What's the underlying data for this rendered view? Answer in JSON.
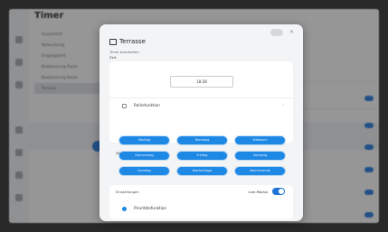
{
  "app": {
    "title": "Timer",
    "list_items": [
      "Aussenlicht",
      "Beleuchtung",
      "Eingangslicht",
      "Bewässerung Rasen",
      "Bewässerung Beete",
      "Terrasse"
    ],
    "selected_index": 5
  },
  "dialog": {
    "title": "Terrasse",
    "subtitle": "Timer bearbeiten",
    "section_label": "Zeit",
    "close_glyph": "×",
    "time_value": "18:28",
    "repeat_label": "Reihefunktion",
    "weekday_heading": "Wiederholung an jedem",
    "weekday_buttons": [
      "Montag",
      "Dienstag",
      "Mittwoch",
      "Donnerstag",
      "Freitag",
      "Samstag",
      "Sonntag",
      "Wochentage",
      "Wochenende"
    ],
    "settings_label": "Einstellungen",
    "live_mode_label": "Live-Modus",
    "priority_label": "Prioritätsfunktion"
  },
  "colors": {
    "accent": "#1e88e5",
    "toggle": "#1e74d6"
  }
}
